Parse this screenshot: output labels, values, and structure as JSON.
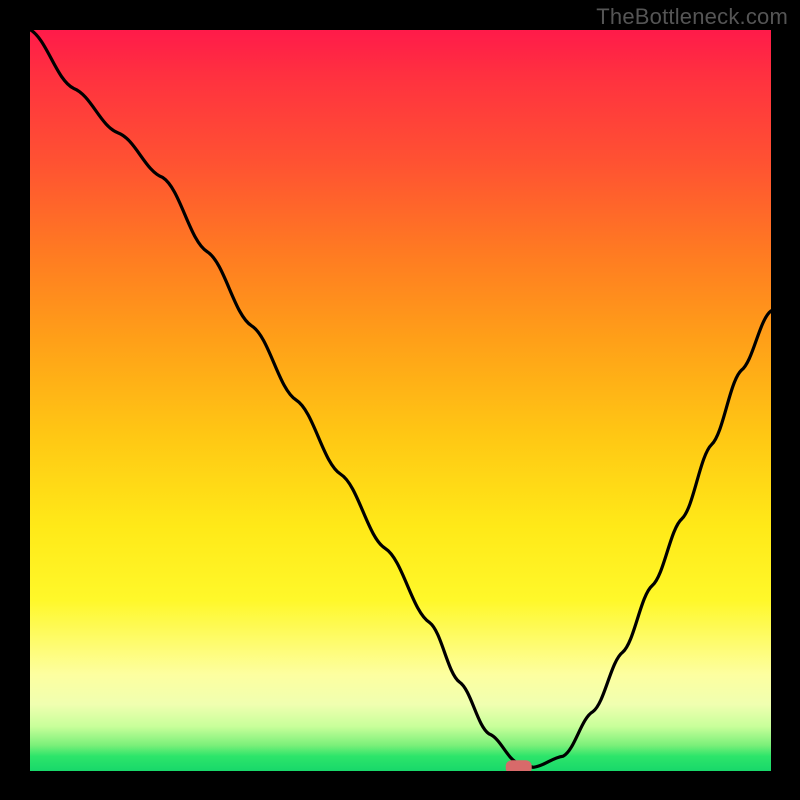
{
  "watermark": "TheBottleneck.com",
  "chart_data": {
    "type": "line",
    "title": "",
    "xlabel": "",
    "ylabel": "",
    "xlim": [
      0,
      100
    ],
    "ylim": [
      0,
      100
    ],
    "grid": false,
    "legend": false,
    "background_gradient": {
      "orientation": "vertical",
      "stops": [
        {
          "pos": 0.0,
          "color": "#ff1a4a"
        },
        {
          "pos": 0.5,
          "color": "#ffc000"
        },
        {
          "pos": 0.8,
          "color": "#ffff40"
        },
        {
          "pos": 1.0,
          "color": "#18d86a"
        }
      ]
    },
    "series": [
      {
        "name": "bottleneck-curve",
        "color": "#000000",
        "x": [
          0,
          6,
          12,
          18,
          24,
          30,
          36,
          42,
          48,
          54,
          58,
          62,
          66,
          68,
          72,
          76,
          80,
          84,
          88,
          92,
          96,
          100
        ],
        "y": [
          100,
          92,
          86,
          80,
          70,
          60,
          50,
          40,
          30,
          20,
          12,
          5,
          1,
          0.5,
          2,
          8,
          16,
          25,
          34,
          44,
          54,
          62
        ]
      }
    ],
    "marker": {
      "name": "optimal-point",
      "x": 66,
      "y": 0.5,
      "shape": "rounded-rect",
      "color": "#d86a6a"
    }
  }
}
